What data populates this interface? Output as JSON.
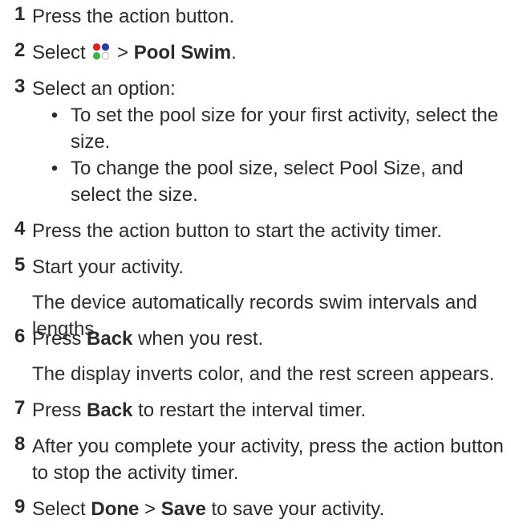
{
  "steps": [
    {
      "num": "1",
      "text": "Press the action button."
    },
    {
      "num": "2",
      "pre": "Select",
      "icon": "apps-icon",
      "sep": ">",
      "bold": "Pool Swim",
      "post": "."
    },
    {
      "num": "3",
      "text": "Select an option:",
      "bullets": [
        "To set the pool size for your first activity, select the size.",
        "To change the pool size, select Pool Size, and select the size."
      ]
    },
    {
      "num": "4",
      "text": "Press the action button to start the activity timer."
    },
    {
      "num": "5",
      "text": "Start your activity.",
      "note": "The device automatically records swim intervals and lengths."
    },
    {
      "num": "6",
      "pre": "Press",
      "bold": "Back",
      "post": "when you rest.",
      "note": "The display inverts color, and the rest screen appears."
    },
    {
      "num": "7",
      "pre": "Press",
      "bold": "Back",
      "post": "to restart the interval timer."
    },
    {
      "num": "8",
      "text": "After you complete your activity, press the action button to stop the activity timer."
    },
    {
      "num": "9",
      "pre": "Select",
      "bold": "Done",
      "sep": ">",
      "bold2": "Save",
      "post": "to save your activity."
    }
  ],
  "bullet_char": "•",
  "colors": {
    "text": "#2b2b2b",
    "icon_red": "#e0201b",
    "icon_blue": "#2a3fa0",
    "icon_green": "#3bb44a",
    "icon_outline": "#b5b5b5"
  }
}
